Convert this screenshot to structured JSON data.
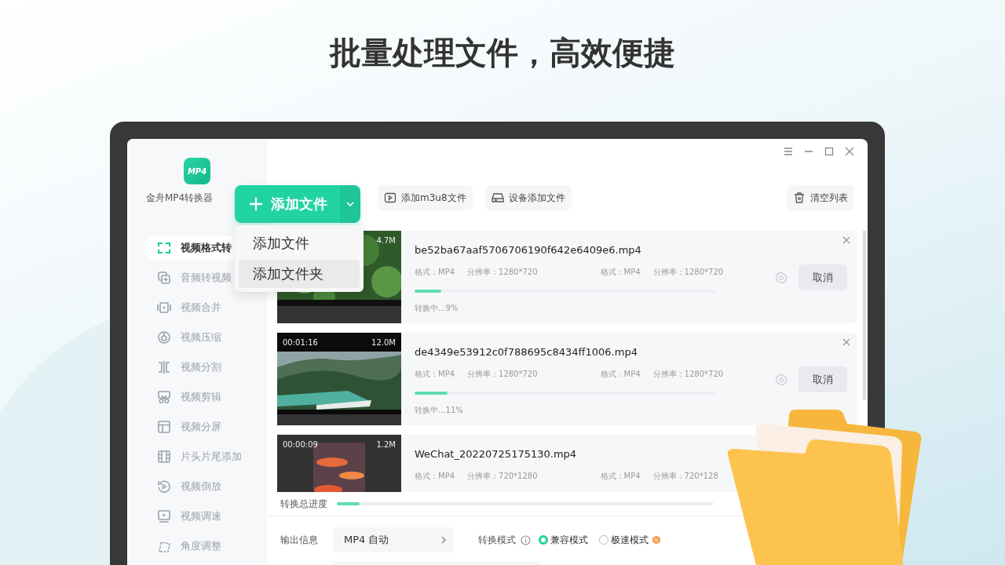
{
  "headline": "批量处理文件，高效便捷",
  "app": {
    "logo_text": "MP4",
    "name": "金舟MP4转换器"
  },
  "sidebar": {
    "items": [
      {
        "label": "视频格式转",
        "selected": true
      },
      {
        "label": "音频转视频",
        "selected": false
      },
      {
        "label": "视频合并",
        "selected": false
      },
      {
        "label": "视频压缩",
        "selected": false
      },
      {
        "label": "视频分割",
        "selected": false
      },
      {
        "label": "视频剪辑",
        "selected": false
      },
      {
        "label": "视频分屏",
        "selected": false
      },
      {
        "label": "片头片尾添加",
        "selected": false
      },
      {
        "label": "视频倒放",
        "selected": false
      },
      {
        "label": "视频调速",
        "selected": false
      },
      {
        "label": "角度调整",
        "selected": false
      }
    ]
  },
  "toolbar": {
    "add_button": "添加文件",
    "menu": [
      {
        "label": "添加文件",
        "selected": false
      },
      {
        "label": "添加文件夹",
        "selected": true
      }
    ],
    "buttons": [
      "添加m3u8文件",
      "设备添加文件"
    ],
    "clear_button": "清空列表"
  },
  "files": [
    {
      "size": "4.7M",
      "name": "be52ba67aaf5706706190f642e6409e6.mp4",
      "meta_in": [
        "格式：MP4",
        "分辨率：1280*720"
      ],
      "meta_out": [
        "格式：MP4",
        "分辨率：1280*720"
      ],
      "level": 0.09,
      "status": "转换中...9%",
      "action": "取消"
    },
    {
      "duration": "00:01:16",
      "size": "12.0M",
      "name": "de4349e53912c0f788695c8434ff1006.mp4",
      "meta_in": [
        "格式：MP4",
        "分辨率：1280*720"
      ],
      "meta_out": [
        "格式：MP4",
        "分辨率：1280*720"
      ],
      "level": 0.11,
      "status": "转换中...11%",
      "action": "取消"
    },
    {
      "duration": "00:00:09",
      "size": "1.2M",
      "name": "WeChat_20220725175130.mp4",
      "meta_in": [
        "格式：MP4",
        "分辨率：720*1280"
      ],
      "meta_out": [
        "格式：MP4",
        "分辨率：720*128"
      ]
    }
  ],
  "total_progress": {
    "label": "转换总进度",
    "level": 0.06
  },
  "output": {
    "label": "输出信息",
    "format": "MP4 自动",
    "mode_label": "转换模式",
    "modes": [
      {
        "label": "兼容模式",
        "selected": true
      },
      {
        "label": "极速模式",
        "selected": false
      }
    ]
  }
}
